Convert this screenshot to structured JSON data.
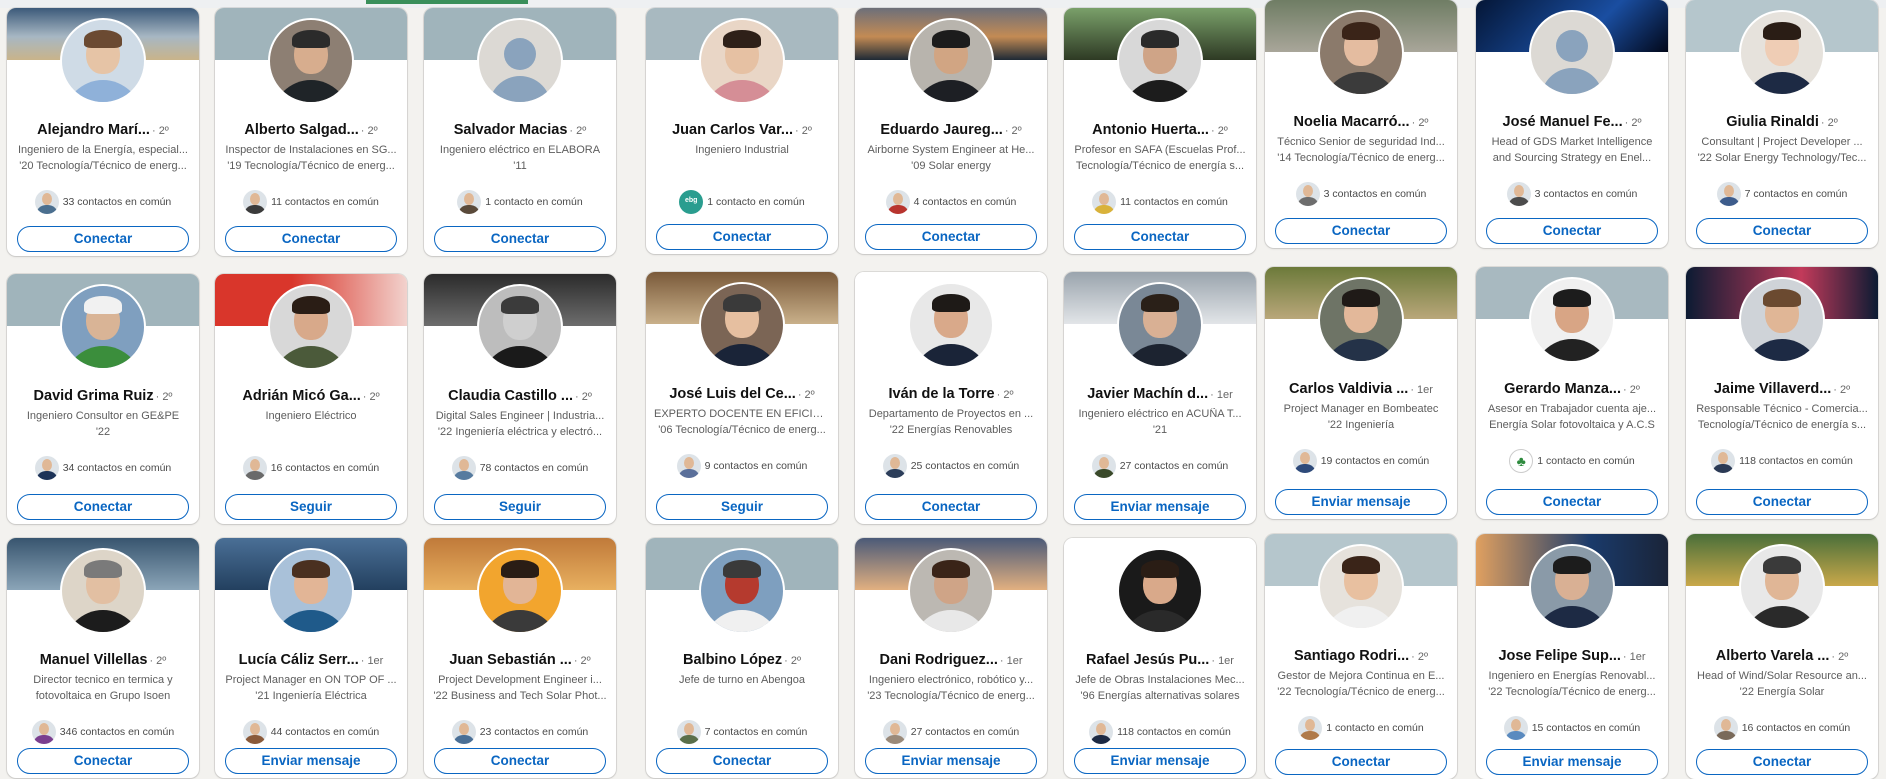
{
  "colors": {
    "accent_blue": "#0a66c2",
    "page_background": "#f3f2ef",
    "card_background": "#ffffff"
  },
  "panels": [
    {
      "name": "panel-left",
      "cards": [
        {
          "name_text": "Alejandro Marí...",
          "degree": "· 2º",
          "headline1": "Ingeniero de la Energía, especial...",
          "headline2": "'20 Tecnología/Técnico de energ...",
          "mutual": "33 contactos en común",
          "action": "Conectar",
          "banner": "linear-gradient(180deg,#3c5a7a 0%,#a7b7c3 55%,#c9b48a 100%)",
          "skin": "#e6c4a6",
          "hair": "#6b4a32",
          "shirt": "#8fb1d9",
          "bg": "#cfdbe6",
          "mini": "#4b6f8f"
        },
        {
          "name_text": "Alberto Salgad...",
          "degree": "· 2º",
          "headline1": "Inspector de Instalaciones en SG...",
          "headline2": "'19 Tecnología/Técnico de energ...",
          "mutual": "11 contactos en común",
          "action": "Conectar",
          "banner": "#a0b4bb",
          "skin": "#d7ad8e",
          "hair": "#2b2b2b",
          "shirt": "#1f2428",
          "bg": "#8d7f73",
          "mini": "#3b3b3b"
        },
        {
          "name_text": "Salvador Macias",
          "degree": "· 2º",
          "headline1": "Ingeniero eléctrico en ELABORA",
          "headline2": "'11",
          "mutual": "1 contacto en común",
          "action": "Conectar",
          "banner": "#a0b4bb",
          "ghost": true,
          "mini": "#5a4a3a"
        }
      ]
    }
  ],
  "cards": [
    {
      "name_text": "Alejandro Marí...",
      "degree": "· 2º",
      "headline1": "Ingeniero de la Energía, especial...",
      "headline2": "'20 Tecnología/Técnico de energ...",
      "mutual": "33 contactos en común",
      "action": "Conectar"
    },
    {
      "name_text": "Alberto Salgad...",
      "degree": "· 2º",
      "headline1": "Inspector de Instalaciones en SG...",
      "headline2": "'19 Tecnología/Técnico de energ...",
      "mutual": "11 contactos en común",
      "action": "Conectar"
    },
    {
      "name_text": "Salvador Macias",
      "degree": "· 2º",
      "headline1": "Ingeniero eléctrico en ELABORA",
      "headline2": "'11",
      "mutual": "1 contacto en común",
      "action": "Conectar"
    },
    {
      "name_text": "Juan Carlos Var...",
      "degree": "· 2º",
      "headline1": "Ingeniero Industrial",
      "headline2": "",
      "mutual": "1 contacto en común",
      "action": "Conectar"
    },
    {
      "name_text": "Eduardo Jaureg...",
      "degree": "· 2º",
      "headline1": "Airborne System Engineer at He...",
      "headline2": "'09 Solar energy",
      "mutual": "4 contactos en común",
      "action": "Conectar"
    },
    {
      "name_text": "Antonio Huerta...",
      "degree": "· 2º",
      "headline1": "Profesor en SAFA (Escuelas Prof...",
      "headline2": "Tecnología/Técnico de energía s...",
      "mutual": "11 contactos en común",
      "action": "Conectar"
    },
    {
      "name_text": "Noelia Macarró...",
      "degree": "· 2º",
      "headline1": "Técnico Senior de seguridad Ind...",
      "headline2": "'14 Tecnología/Técnico de energ...",
      "mutual": "3 contactos en común",
      "action": "Conectar"
    },
    {
      "name_text": "José Manuel Fe...",
      "degree": "· 2º",
      "headline1": "Head of GDS Market Intelligence",
      "headline2": "and Sourcing Strategy en Enel...",
      "mutual": "3 contactos en común",
      "action": "Conectar"
    },
    {
      "name_text": "Giulia Rinaldi",
      "degree": "· 2º",
      "headline1": "Consultant | Project Developer ...",
      "headline2": "'22 Solar Energy Technology/Tec...",
      "mutual": "7 contactos en común",
      "action": "Conectar"
    },
    {
      "name_text": "David Grima Ruiz",
      "degree": "· 2º",
      "headline1": "Ingeniero Consultor en GE&PE",
      "headline2": "'22",
      "mutual": "34 contactos en común",
      "action": "Conectar"
    },
    {
      "name_text": "Adrián Micó Ga...",
      "degree": "· 2º",
      "headline1": "Ingeniero Eléctrico",
      "headline2": "",
      "mutual": "16 contactos en común",
      "action": "Seguir"
    },
    {
      "name_text": "Claudia Castillo ...",
      "degree": "· 2º",
      "headline1": "Digital Sales Engineer | Industria...",
      "headline2": "'22 Ingeniería eléctrica y electró...",
      "mutual": "78 contactos en común",
      "action": "Seguir"
    },
    {
      "name_text": "José Luis del Ce...",
      "degree": "· 2º",
      "headline1": "EXPERTO DOCENTE EN EFICIEN...",
      "headline2": "'06 Tecnología/Técnico de energ...",
      "mutual": "9 contactos en común",
      "action": "Seguir"
    },
    {
      "name_text": "Iván de la Torre",
      "degree": "· 2º",
      "headline1": "Departamento de Proyectos en ...",
      "headline2": "'22 Energías Renovables",
      "mutual": "25 contactos en común",
      "action": "Conectar"
    },
    {
      "name_text": "Javier Machín d...",
      "degree": "· 1er",
      "headline1": "Ingeniero eléctrico en ACUÑA T...",
      "headline2": "'21",
      "mutual": "27 contactos en común",
      "action": "Enviar mensaje"
    },
    {
      "name_text": "Carlos Valdivia ...",
      "degree": "· 1er",
      "headline1": "Project Manager en Bombeatec",
      "headline2": "'22 Ingeniería",
      "mutual": "19 contactos en común",
      "action": "Enviar mensaje"
    },
    {
      "name_text": "Gerardo Manza...",
      "degree": "· 2º",
      "headline1": "Asesor en Trabajador cuenta aje...",
      "headline2": "Energía Solar fotovoltaica y A.C.S",
      "mutual": "1 contacto en común",
      "action": "Conectar"
    },
    {
      "name_text": "Jaime Villaverd...",
      "degree": "· 2º",
      "headline1": "Responsable Técnico - Comercia...",
      "headline2": "Tecnología/Técnico de energía s...",
      "mutual": "118 contactos en común",
      "action": "Conectar"
    },
    {
      "name_text": "Manuel Villellas",
      "degree": "· 2º",
      "headline1": "Director tecnico en termica y",
      "headline2": "fotovoltaica en Grupo Isoen",
      "mutual": "346 contactos en común",
      "action": "Conectar"
    },
    {
      "name_text": "Lucía Cáliz Serr...",
      "degree": "· 1er",
      "headline1": "Project Manager en ON TOP OF ...",
      "headline2": "'21 Ingeniería Eléctrica",
      "mutual": "44 contactos en común",
      "action": "Enviar mensaje"
    },
    {
      "name_text": "Juan Sebastián ...",
      "degree": "· 2º",
      "headline1": "Project Development Engineer i...",
      "headline2": "'22 Business and Tech Solar Phot...",
      "mutual": "23 contactos en común",
      "action": "Conectar"
    },
    {
      "name_text": "Balbino López",
      "degree": "· 2º",
      "headline1": "Jefe de turno en Abengoa",
      "headline2": "",
      "mutual": "7 contactos en común",
      "action": "Conectar"
    },
    {
      "name_text": "Dani Rodriguez...",
      "degree": "· 1er",
      "headline1": "Ingeniero electrónico, robótico y...",
      "headline2": "'23 Tecnología/Técnico de energ...",
      "mutual": "27 contactos en común",
      "action": "Enviar mensaje"
    },
    {
      "name_text": "Rafael Jesús Pu...",
      "degree": "· 1er",
      "headline1": "Jefe de Obras Instalaciones Mec...",
      "headline2": "'96 Energías alternativas solares",
      "mutual": "118 contactos en común",
      "action": "Enviar mensaje"
    },
    {
      "name_text": "Santiago Rodri...",
      "degree": "· 2º",
      "headline1": "Gestor de Mejora Continua en E...",
      "headline2": "'22 Tecnología/Técnico de energ...",
      "mutual": "1 contacto en común",
      "action": "Conectar"
    },
    {
      "name_text": "Jose Felipe Sup...",
      "degree": "· 1er",
      "headline1": "Ingeniero en Energías Renovabl...",
      "headline2": "'22 Tecnología/Técnico de energ...",
      "mutual": "15 contactos en común",
      "action": "Enviar mensaje"
    },
    {
      "name_text": "Alberto Varela ...",
      "degree": "· 2º",
      "headline1": "Head of Wind/Solar Resource an...",
      "headline2": "'22 Energía Solar",
      "mutual": "16 contactos en común",
      "action": "Conectar"
    }
  ]
}
